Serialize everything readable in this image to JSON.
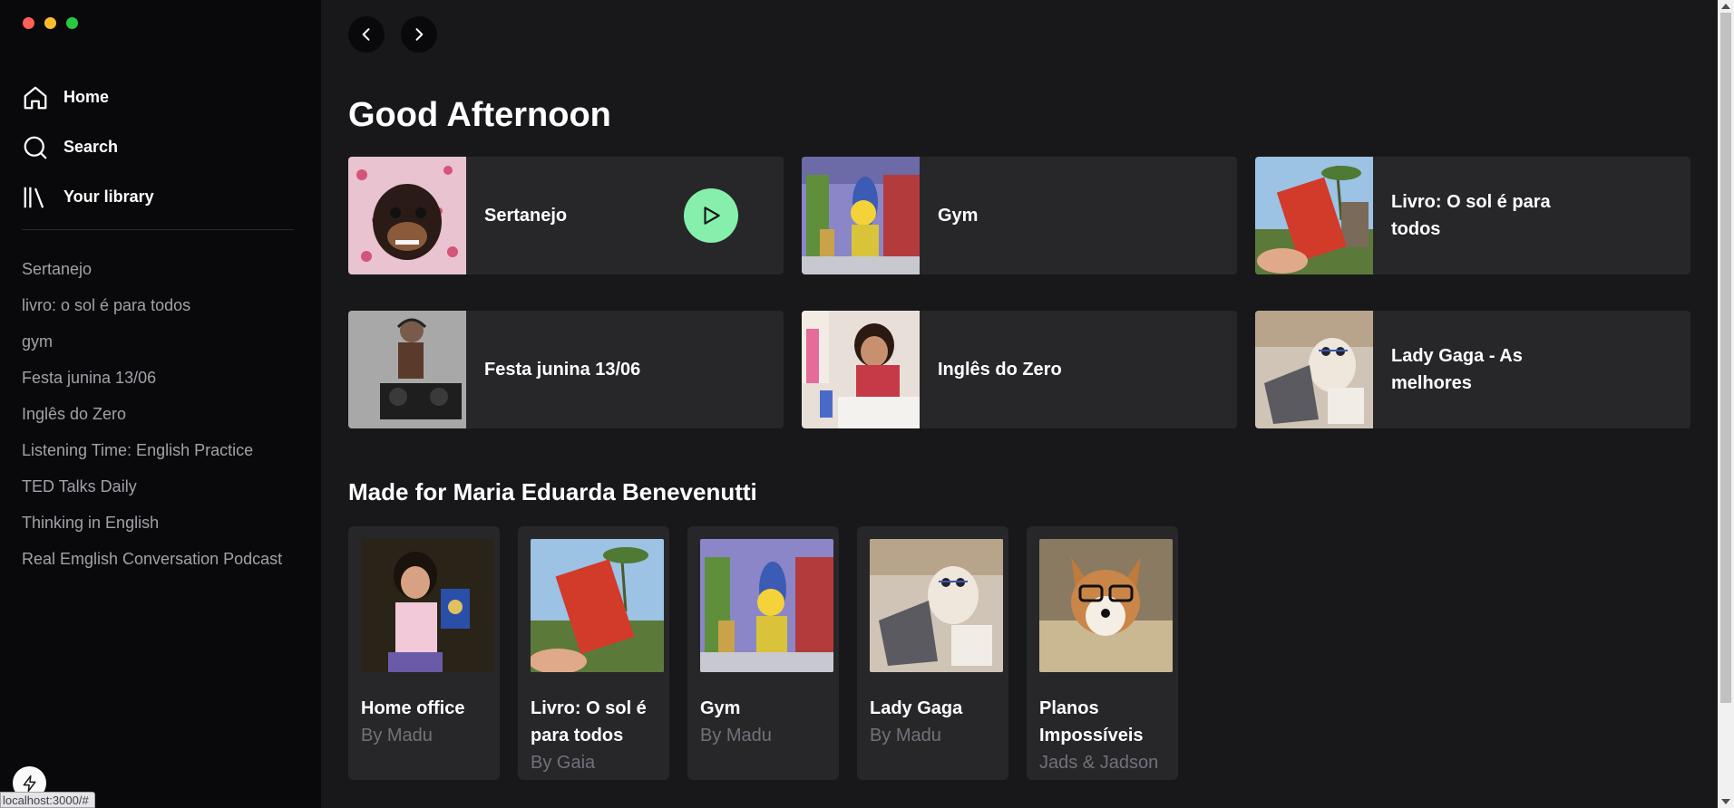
{
  "colors": {
    "sidebar_bg": "#09090b",
    "main_bg": "#18181b",
    "card_bg": "#27272a",
    "accent_play": "#86efac",
    "muted_text": "#a1a1aa"
  },
  "window": {
    "traffic_lights": [
      "close",
      "minimize",
      "maximize"
    ]
  },
  "sidebar": {
    "nav": [
      {
        "label": "Home",
        "icon": "home-icon"
      },
      {
        "label": "Search",
        "icon": "search-icon"
      },
      {
        "label": "Your library",
        "icon": "library-icon"
      }
    ],
    "playlists": [
      "Sertanejo",
      "livro: o sol é para todos",
      "gym",
      "Festa junina 13/06",
      "Inglês do Zero",
      "Listening Time: English Practice",
      "TED Talks Daily",
      "Thinking in English",
      "Real Emglish Conversation Podcast"
    ]
  },
  "status_bar": {
    "url": "localhost:3000/#"
  },
  "main": {
    "greeting": "Good Afternoon",
    "featured": [
      {
        "title": "Sertanejo",
        "image": "chihuahua-hearts-image",
        "show_play": true
      },
      {
        "title": "Gym",
        "image": "cartoon-workout-image",
        "show_play": false
      },
      {
        "title": "Livro: O sol é para todos",
        "image": "red-book-palm-image",
        "show_play": false
      },
      {
        "title": "Festa junina 13/06",
        "image": "dj-girl-image",
        "show_play": false
      },
      {
        "title": "Inglês do Zero",
        "image": "girl-studying-image",
        "show_play": false
      },
      {
        "title": "Lady Gaga - As melhores",
        "image": "dog-laptop-image",
        "show_play": false
      }
    ],
    "made_for": {
      "title": "Made for Maria Eduarda Benevenutti",
      "items": [
        {
          "title": "Home office",
          "by": "By Madu",
          "image": "girl-passport-image"
        },
        {
          "title": "Livro: O sol é para todos",
          "by": "By Gaia",
          "image": "red-book-palm-image"
        },
        {
          "title": "Gym",
          "by": "By Madu",
          "image": "cartoon-workout-image"
        },
        {
          "title": "Lady Gaga",
          "by": "By Madu",
          "image": "dog-laptop-image"
        },
        {
          "title": "Planos Impossíveis",
          "by": "Jads & Jadson",
          "image": "corgi-glasses-image"
        }
      ]
    }
  }
}
